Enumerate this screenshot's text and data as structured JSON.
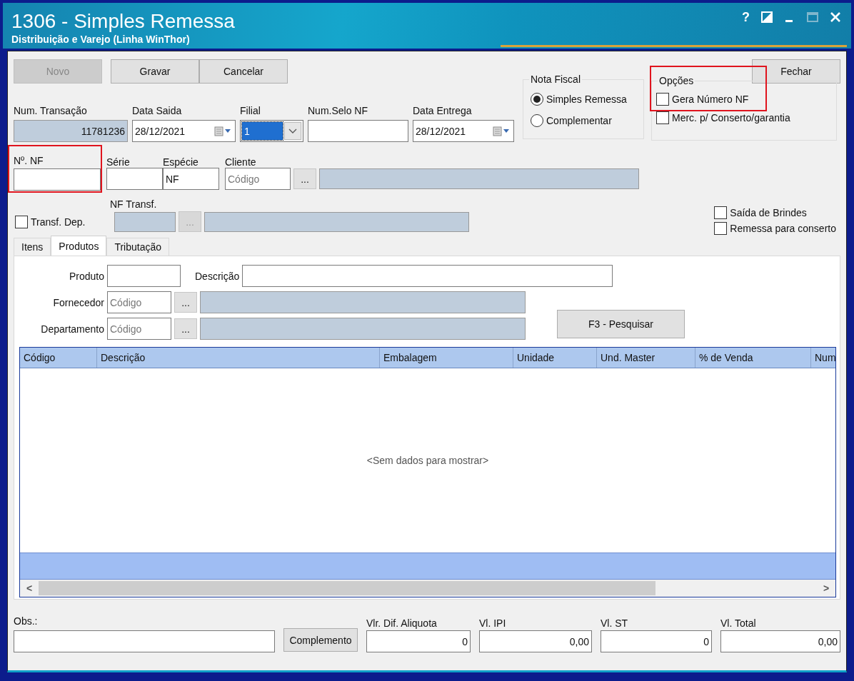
{
  "window": {
    "title": "1306 - Simples Remessa",
    "subtitle": "Distribuição e Varejo (Linha WinThor)",
    "help": "?"
  },
  "toolbar": {
    "buttons": [
      {
        "label": "Novo",
        "disabled": true
      },
      {
        "label": "Gravar",
        "disabled": false
      },
      {
        "label": "Cancelar",
        "disabled": false
      }
    ],
    "close_label": "Fechar"
  },
  "header_fields": {
    "num_transacao": {
      "label": "Num. Transação",
      "value": "11781236"
    },
    "data_saida": {
      "label": "Data Saida",
      "value": "28/12/2021"
    },
    "filial": {
      "label": "Filial",
      "value": "1"
    },
    "num_selo": {
      "label": "Num.Selo NF"
    },
    "data_entrega": {
      "label": "Data Entrega",
      "value": "28/12/2021"
    }
  },
  "nota_fiscal": {
    "title": "Nota Fiscal",
    "options": [
      {
        "label": "Simples Remessa",
        "selected": true
      },
      {
        "label": "Complementar",
        "selected": false
      }
    ]
  },
  "opcoes": {
    "title": "Opções",
    "highlighted": true,
    "options": [
      {
        "label": "Gera Número NF",
        "checked": false
      },
      {
        "label": "Merc. p/ Conserto/garantia",
        "checked": false
      }
    ]
  },
  "nf_fields": {
    "numero": {
      "label": "Nº. NF",
      "highlighted": true
    },
    "serie": {
      "label": "Série"
    },
    "especie": {
      "label": "Espécie",
      "value": "NF"
    },
    "cliente": {
      "label": "Cliente",
      "placeholder": "Código",
      "lookup": "..."
    }
  },
  "transf": {
    "label": "Transf. Dep.",
    "checked": false,
    "nf_label": "NF Transf.",
    "lookup": "..."
  },
  "extra_options": [
    {
      "label": "Saída de Brindes",
      "checked": false
    },
    {
      "label": "Remessa para conserto",
      "checked": false
    }
  ],
  "tabs": [
    {
      "label": "Itens",
      "selected": false
    },
    {
      "label": "Produtos",
      "selected": true
    },
    {
      "label": "Tributação",
      "selected": false
    }
  ],
  "filters": {
    "produto": "Produto",
    "descricao": "Descrição",
    "fornecedor": {
      "label": "Fornecedor",
      "placeholder": "Código",
      "lookup": "..."
    },
    "departamento": {
      "label": "Departamento",
      "placeholder": "Código",
      "lookup": "..."
    },
    "search_button": "F3 - Pesquisar"
  },
  "table": {
    "columns": [
      "Código",
      "Descrição",
      "Embalagem",
      "Unidade",
      "Und. Master",
      "% de Venda",
      "Num"
    ],
    "empty_message": "<Sem dados para mostrar>",
    "scroll_left": "<",
    "scroll_right": ">"
  },
  "footer": {
    "obs_label": "Obs.:",
    "complemento": "Complemento",
    "totals": [
      {
        "label": "Vlr. Dif. Aliquota",
        "value": "0"
      },
      {
        "label": "Vl. IPI",
        "value": "0,00"
      },
      {
        "label": "Vl. ST",
        "value": "0"
      },
      {
        "label": "Vl. Total",
        "value": "0,00"
      }
    ]
  }
}
